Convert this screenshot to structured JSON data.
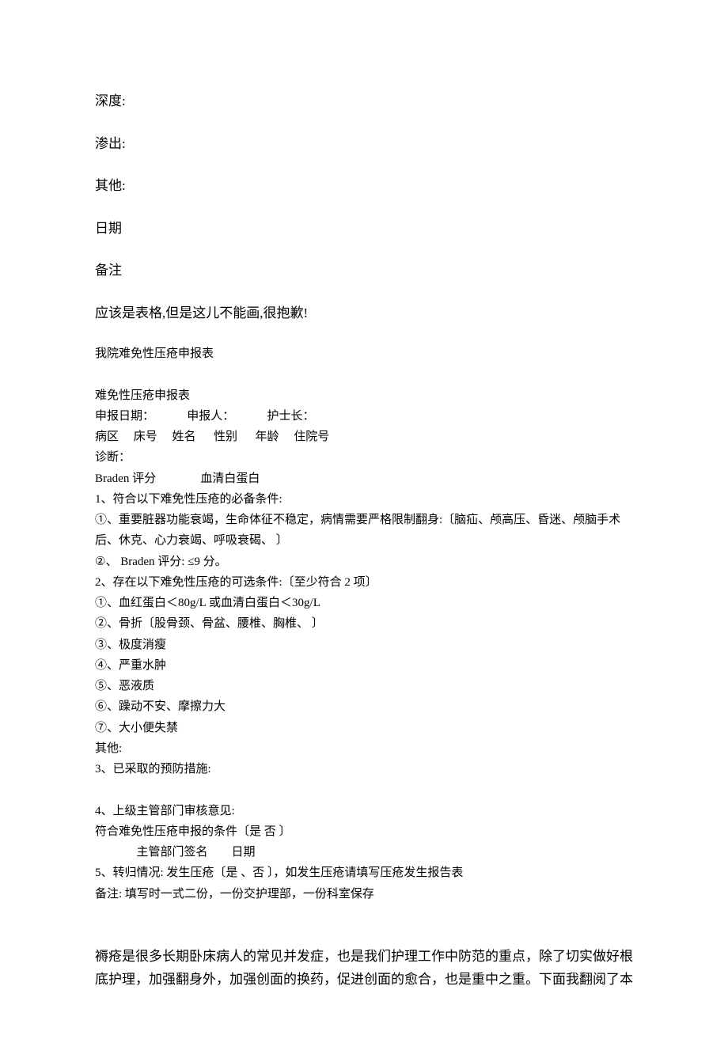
{
  "header": {
    "depth": "深度:",
    "exudate": "渗出:",
    "other": "其他:",
    "date": "日期",
    "remarks": "备注",
    "apology": "应该是表格,但是这儿不能画,很抱歉!"
  },
  "form1": {
    "title": "我院难免性压疮申报表"
  },
  "form2": {
    "title": "难免性压疮申报表",
    "row1": "申报日期：           申报人：           护士长：",
    "row2": "病区     床号     姓名      性别      年龄     住院号",
    "diagnosis": "诊断：",
    "braden": "Braden 评分               血清白蛋白",
    "sec1_title": "1、符合以下难免性压疮的必备条件:",
    "sec1_item1": "①、重要脏器功能衰竭，生命体征不稳定，病情需要严格限制翻身:〔脑疝、颅高压、昏迷、颅脑手术后、休克、心力衰竭、呼吸衰碣、                    〕",
    "sec1_item2": "②、 Braden 评分: ≤9 分。",
    "sec2_title": "2、存在以下难免性压疮的可选条件:〔至少符合 2 项〕",
    "sec2_item1": "①、血红蛋白＜80g/L 或血清白蛋白＜30g/L",
    "sec2_item2": "②、骨折〔股骨颈、骨盆、腰椎、胸椎、                          〕",
    "sec2_item3": "③、极度消瘦",
    "sec2_item4": "④、严重水肿",
    "sec2_item5": "⑤、恶液质",
    "sec2_item6": "⑥、躁动不安、摩擦力大",
    "sec2_item7": "⑦、大小便失禁",
    "sec2_other": "其他:",
    "sec3": "3、已采取的预防措施:",
    "sec4_title": "4、上级主管部门审核意见:",
    "sec4_line1": "符合难免性压疮申报的条件〔是   否 〕",
    "sec4_line2": "              主管部门签名        日期",
    "sec5": "5、转归情况: 发生压疮〔是 、否 〕，如发生压疮请填写压疮发生报告表",
    "note": "备注: 填写时一式二份，一份交护理部，一份科室保存"
  },
  "paragraph": "褥疮是很多长期卧床病人的常见并发症，也是我们护理工作中防范的重点，除了切实做好根底护理，加强翻身外，加强创面的换药，促进创面的愈合，也是重中之重。下面我翻阅了本"
}
